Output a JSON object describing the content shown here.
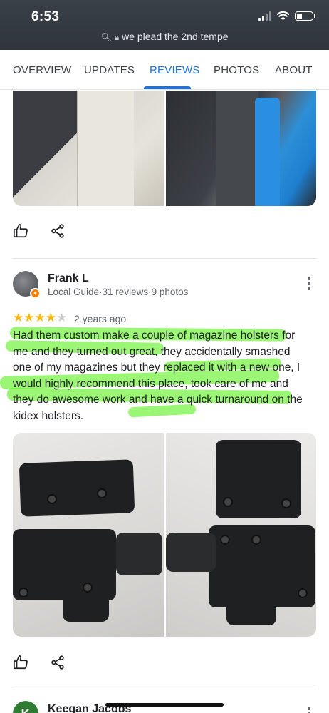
{
  "status_bar": {
    "time": "6:53"
  },
  "browser": {
    "url": "we plead the 2nd tempe"
  },
  "tabs": [
    {
      "label": "OVERVIEW",
      "active": false
    },
    {
      "label": "UPDATES",
      "active": false
    },
    {
      "label": "REVIEWS",
      "active": true
    },
    {
      "label": "PHOTOS",
      "active": false
    },
    {
      "label": "ABOUT",
      "active": false
    }
  ],
  "reviews": [
    {
      "name": "Frank L",
      "meta": "Local Guide·31 reviews·9 photos",
      "rating": 4,
      "rating_max": 5,
      "date": "2 years ago",
      "text": "Had them custom make a couple of magazine holsters for me and they turned out great, they accidentally smashed one of my magazines but they replaced it with a new one, I would highly recommend this place, took care of me and they do awesome work and have a quick turnaround on the kidex holsters."
    },
    {
      "name": "Keegan Jacobs",
      "avatar_letter": "K"
    }
  ],
  "colors": {
    "accent": "#1a73e8",
    "star": "#f6b400",
    "highlighter": "#5cf01e",
    "badge": "#f57c00"
  },
  "icons": [
    "thumbs-up-icon",
    "share-icon",
    "more-vert-icon",
    "search-icon",
    "lock-icon",
    "signal-icon",
    "wifi-icon",
    "battery-icon"
  ]
}
